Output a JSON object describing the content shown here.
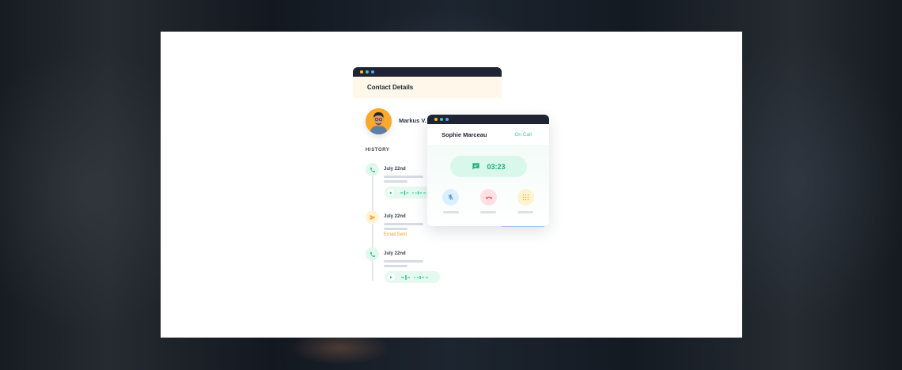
{
  "contact_window": {
    "title": "Contact Details",
    "contact_name": "Markus V.",
    "history_label": "HISTORY",
    "history": [
      {
        "date": "July 22nd",
        "type": "call",
        "icon": "phone-icon"
      },
      {
        "date": "July 22nd",
        "type": "email",
        "icon": "send-icon",
        "status": "Email Sent"
      },
      {
        "date": "July 22nd",
        "type": "call",
        "icon": "phone-icon"
      }
    ]
  },
  "call_window": {
    "caller_name": "Sophie Marceau",
    "status": "On Call",
    "timer": "03:23",
    "controls": [
      "mute-icon",
      "end-call-icon",
      "keypad-icon"
    ]
  },
  "colors": {
    "accent_green": "#34d399",
    "titlebar": "#1f2333",
    "email_orange": "#f0a21c",
    "end_call_red": "#f0566a"
  }
}
